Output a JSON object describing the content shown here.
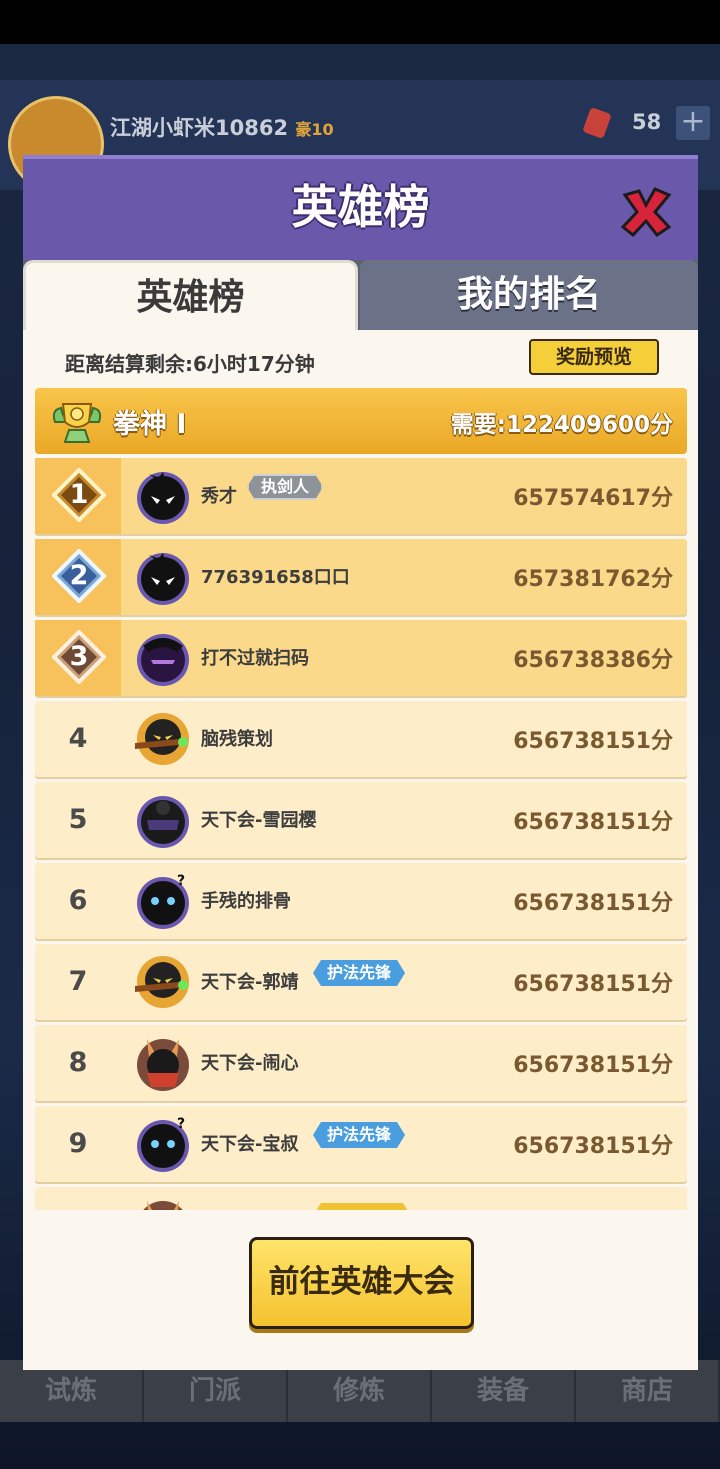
{
  "background": {
    "player_name": "江湖小虾米10862",
    "vip": "豪10",
    "gems": "58",
    "nav": [
      "试炼",
      "门派",
      "修炼",
      "装备",
      "商店"
    ]
  },
  "dialog": {
    "title": "英雄榜",
    "tabs": [
      {
        "label": "英雄榜",
        "active": true
      },
      {
        "label": "我的排名",
        "active": false
      }
    ],
    "countdown": "距离结算剩余:6小时17分钟",
    "reward_preview": "奖励预览",
    "tier": {
      "name": "拳神 I",
      "requirement": "需要:122409600分"
    },
    "rows": [
      {
        "rank": "1",
        "name": "秀才",
        "badge": "执剑人",
        "badge_style": "silver",
        "score": "657574617分",
        "avatar": "shadow-ninja-avatar"
      },
      {
        "rank": "2",
        "name": "776391658口口",
        "badge": "",
        "badge_style": "",
        "score": "657381762分",
        "avatar": "shadow-ninja-avatar"
      },
      {
        "rank": "3",
        "name": "打不过就扫码",
        "badge": "",
        "badge_style": "",
        "score": "656738386分",
        "avatar": "purple-assassin-avatar"
      },
      {
        "rank": "4",
        "name": "脑残策划",
        "badge": "",
        "badge_style": "",
        "score": "656738151分",
        "avatar": "gold-gunner-avatar"
      },
      {
        "rank": "5",
        "name": "天下会-雪园樱",
        "badge": "",
        "badge_style": "",
        "score": "656738151分",
        "avatar": "masked-assassin-avatar"
      },
      {
        "rank": "6",
        "name": "手残的排骨",
        "badge": "",
        "badge_style": "",
        "score": "656738151分",
        "avatar": "question-ninja-avatar"
      },
      {
        "rank": "7",
        "name": "天下会-郭靖",
        "badge": "护法先锋",
        "badge_style": "blue",
        "score": "656738151分",
        "avatar": "gold-gunner-avatar"
      },
      {
        "rank": "8",
        "name": "天下会-闹心",
        "badge": "",
        "badge_style": "",
        "score": "656738151分",
        "avatar": "fox-warrior-avatar"
      },
      {
        "rank": "9",
        "name": "天下会-宝叔",
        "badge": "护法先锋",
        "badge_style": "blue",
        "score": "656738151分",
        "avatar": "question-ninja-avatar"
      }
    ],
    "goto_button": "前往英雄大会"
  },
  "colors": {
    "title_bar": "#6a58ab",
    "tier_bar": "#f0b637",
    "row_bg": "#fdedc8",
    "top_row_bg": "#fbd98a",
    "score": "#7a5830"
  }
}
